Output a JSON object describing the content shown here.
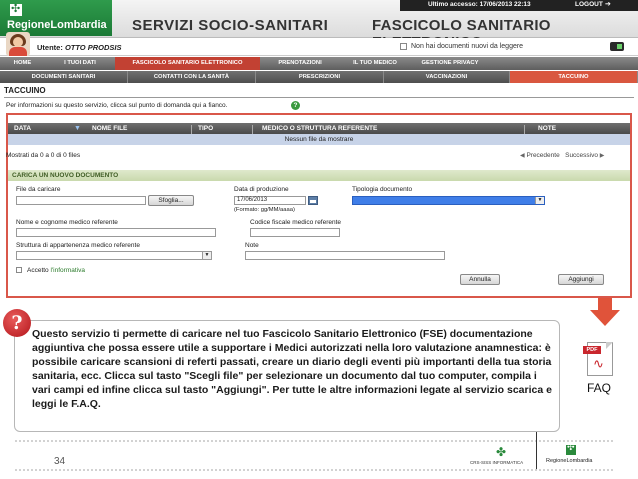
{
  "header": {
    "brand": "RegioneLombardia",
    "service_title": "SERVIZI SOCIO-SANITARI",
    "fse_title": "FASCICOLO SANITARIO ELETTRONICO",
    "last_access": "Ultimo accesso: 17/06/2013 22:13",
    "logout": "LOGOUT"
  },
  "user": {
    "label": "Utente:",
    "name": "OTTO PRODSIS",
    "no_docs_notice": "Non hai documenti nuovi da leggere"
  },
  "nav_primary": [
    "HOME",
    "I TUOI DATI",
    "FASCICOLO SANITARIO ELETTRONICO",
    "PRENOTAZIONI",
    "IL TUO MEDICO",
    "GESTIONE PRIVACY"
  ],
  "nav_secondary": [
    "DOCUMENTI SANITARI",
    "CONTATTI CON LA SANITÀ",
    "PRESCRIZIONI",
    "VACCINAZIONI",
    "TACCUINO"
  ],
  "page": {
    "title": "TACCUINO",
    "help_text": "Per informazioni su questo servizio, clicca sul punto di domanda qui a fianco."
  },
  "table": {
    "columns": [
      "DATA",
      "NOME FILE",
      "TIPO",
      "MEDICO O STRUTTURA REFERENTE",
      "NOTE"
    ],
    "empty_message": "Nessun file da mostrare",
    "showing": "Mostrati da 0 a 0 di 0 files",
    "prev": "Precedente",
    "next": "Successivo"
  },
  "upload": {
    "section_title": "CARICA UN NUOVO DOCUMENTO",
    "file_label": "File da caricare",
    "browse_button": "Sfoglia...",
    "date_label": "Data di produzione",
    "date_value": "17/06/2013",
    "date_format": "(Formato: gg/MM/aaaa)",
    "type_label": "Tipologia documento",
    "doctor_name_label": "Nome e cognome medico referente",
    "fiscal_code_label": "Codice fiscale medico referente",
    "structure_label": "Struttura di appartenenza medico referente",
    "notes_label": "Note",
    "accept_prefix": "Accetto ",
    "accept_link": "l'informativa",
    "cancel_button": "Annulla",
    "add_button": "Aggiungi"
  },
  "callout": {
    "badge": "?",
    "text": "Questo servizio ti permette di caricare nel tuo Fascicolo Sanitario Elettronico (FSE) documentazione aggiuntiva che possa essere utile a supportare i Medici autorizzati nella loro valutazione anamnestica: è possibile caricare scansioni di referti passati, creare un diario degli eventi più importanti della tua storia sanitaria, ecc. Clicca sul tasto \"Scegli file\" per selezionare un documento dal tuo computer, compila i vari campi ed infine clicca sul tasto \"Aggiungi\". Per tutte le altre informazioni legate al servizio scarica e leggi le F.A.Q."
  },
  "faq": {
    "pdf_tag": "PDF",
    "label": "FAQ"
  },
  "footer": {
    "page_number": "34",
    "logo1": "CRS-SISS INFORMATICA",
    "logo2": "RegioneLombardia"
  },
  "colors": {
    "brand_green": "#1b7a36",
    "active_tab": "#c24133",
    "frame_red": "#d9574a",
    "arrow_orange": "#e0533a",
    "badge_red": "#b3151a"
  }
}
